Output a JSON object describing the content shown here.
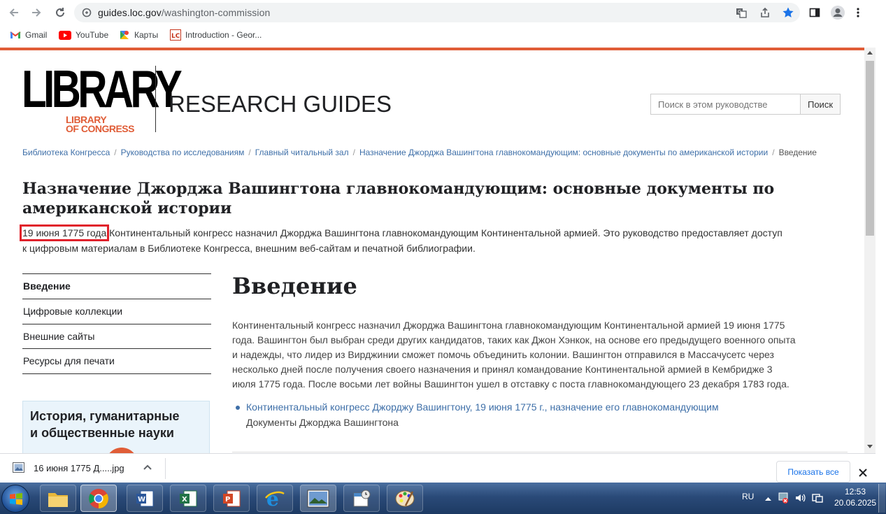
{
  "browser": {
    "url_host": "guides.loc.gov",
    "url_path": "/washington-commission",
    "bookmarks": [
      {
        "label": "Gmail",
        "icon": "gmail-icon"
      },
      {
        "label": "YouTube",
        "icon": "youtube-icon"
      },
      {
        "label": "Карты",
        "icon": "maps-icon"
      },
      {
        "label": "Introduction - Geor...",
        "icon": "loc-icon"
      }
    ],
    "colors": {
      "accent": "#1a73e8",
      "brand_red": "#e05d37"
    }
  },
  "header": {
    "logo_main": "LIBRARY",
    "logo_sub_1": "LIBRARY",
    "logo_sub_2": "OF CONGRESS",
    "section_title": "RESEARCH GUIDES",
    "search_placeholder": "Поиск в этом руководстве",
    "search_button": "Поиск"
  },
  "breadcrumb": [
    "Библиотека Конгресса",
    "Руководства по исследованиям",
    "Главный читальный зал",
    "Назначение Джорджа Вашингтона главнокомандующим: основные документы по американской истории",
    "Введение"
  ],
  "guide": {
    "title_line1": "Назначение Джорджа Вашингтона главнокомандующим: основные документы по",
    "title_line2": "американской истории",
    "intro_highlight": "19 июня 1775 года",
    "intro_rest_line1": " Континентальный конгресс назначил Джорджа Вашингтона главнокомандующим Континентальной армией. Это руководство предоставляет доступ",
    "intro_line2": "к цифровым материалам в Библиотеке Конгресса, внешним веб-сайтам и печатной библиографии."
  },
  "sidenav": {
    "items": [
      "Введение",
      "Цифровые коллекции",
      "Внешние сайты",
      "Ресурсы для печати"
    ],
    "active_index": 0,
    "box_title_line1": "История, гуманитарные",
    "box_title_line2": "и общественные науки"
  },
  "main": {
    "heading": "Введение",
    "para": [
      "Континентальный конгресс назначил Джорджа Вашингтона главнокомандующим Континентальной армией 19 июня 1775",
      "года. Вашингтон был выбран среди других кандидатов, таких как Джон Хэнкок, на основе его предыдущего военного опыта",
      "и надежды, что лидер из Вирджинии сможет помочь объединить колонии. Вашингтон отправился в Массачусетс через",
      "несколько дней после получения своего назначения и принял командование Континентальной армией в Кембридже 3",
      "июля 1775 года. После восьми лет войны Вашингтон ушел в отставку с поста главнокомандующего 23 декабря 1783 года."
    ],
    "link_text": "Континентальный конгресс Джорджу Вашингтону, 19 июня 1775 г., назначение его главнокомандующим",
    "link_sub": "Документы Джорджа Вашингтона"
  },
  "downloads": {
    "file_name": "16 июня 1775 Д.....jpg",
    "show_all": "Показать все"
  },
  "taskbar": {
    "lang": "RU",
    "time": "12:53",
    "date": "20.06.2025"
  }
}
